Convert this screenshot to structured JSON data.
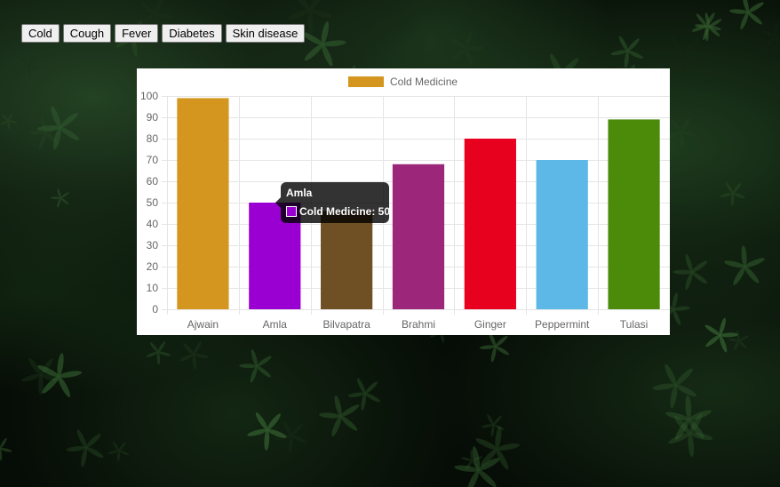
{
  "buttons": [
    {
      "label": "Cold"
    },
    {
      "label": "Cough"
    },
    {
      "label": "Fever"
    },
    {
      "label": "Diabetes"
    },
    {
      "label": "Skin disease"
    }
  ],
  "chart_data": {
    "type": "bar",
    "title": "",
    "legend": {
      "label": "Cold Medicine",
      "color": "#d4961f",
      "position": "top"
    },
    "categories": [
      "Ajwain",
      "Amla",
      "Bilvapatra",
      "Brahmi",
      "Ginger",
      "Peppermint",
      "Tulasi"
    ],
    "series": [
      {
        "name": "Cold Medicine",
        "values": [
          99,
          50,
          46,
          68,
          80,
          70,
          89
        ],
        "colors": [
          "#d4961f",
          "#9b00d3",
          "#6e5024",
          "#9c277a",
          "#e8001f",
          "#5db8e8",
          "#4c8a0a"
        ]
      }
    ],
    "ylim": [
      0,
      100
    ],
    "yticks": [
      0,
      10,
      20,
      30,
      40,
      50,
      60,
      70,
      80,
      90,
      100
    ],
    "grid": true,
    "tick_color": "#666666",
    "grid_color": "#e5e5e5"
  },
  "tooltip": {
    "title": "Amla",
    "label": "Cold Medicine: 50",
    "swatch_color": "#9b00d3"
  }
}
